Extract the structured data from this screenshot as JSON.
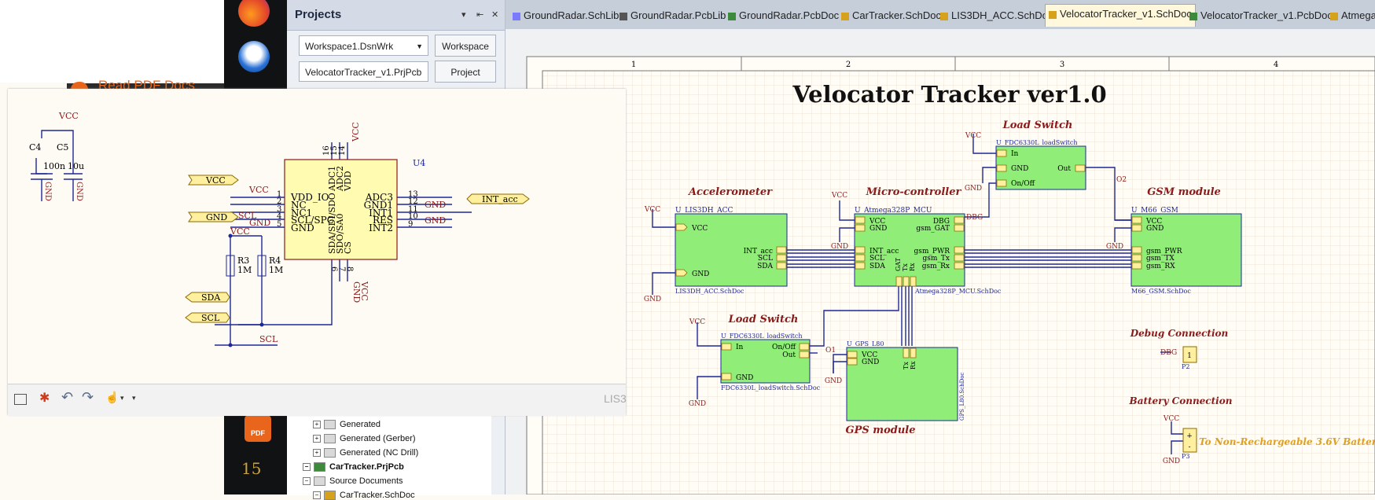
{
  "window": {
    "overlay_label": "LIS3"
  },
  "projects_panel": {
    "title": "Projects",
    "header_buttons": [
      "▾",
      "⇤",
      "✕"
    ],
    "workspace_combo": "Workspace1.DsnWrk",
    "workspace_button": "Workspace",
    "project_combo": "VelocatorTracker_v1.PrjPcb",
    "project_button": "Project",
    "tree": [
      {
        "label": "Generated",
        "type": "folder"
      },
      {
        "label": "Generated (Gerber)",
        "type": "folder"
      },
      {
        "label": "Generated (NC Drill)",
        "type": "folder"
      },
      {
        "label": "CarTracker.PrjPcb",
        "type": "project"
      },
      {
        "label": "Source Documents",
        "type": "folder"
      },
      {
        "label": "CarTracker.SchDoc",
        "type": "file"
      }
    ]
  },
  "taskbar": {
    "icons": [
      "firefox-icon",
      "thunderbird-icon",
      "pdf-app-icon",
      "number-app-icon"
    ],
    "pdf_app_label": "PDF",
    "number_app_label": "15",
    "banner_text": "Read PDF Docs"
  },
  "tabs": [
    {
      "label": "GroundRadar.SchLib",
      "active": false,
      "color": "#7a7aff"
    },
    {
      "label": "GroundRadar.PcbLib",
      "active": false,
      "color": "#555555"
    },
    {
      "label": "GroundRadar.PcbDoc",
      "active": false,
      "color": "#3d8a3d"
    },
    {
      "label": "CarTracker.SchDoc",
      "active": false,
      "color": "#d6a21b"
    },
    {
      "label": "LIS3DH_ACC.SchDoc",
      "active": false,
      "color": "#d6a21b"
    },
    {
      "label": "VelocatorTracker_v1.SchDoc",
      "active": true,
      "color": "#d6a21b"
    },
    {
      "label": "VelocatorTracker_v1.PcbDoc",
      "active": false,
      "color": "#3d8a3d"
    },
    {
      "label": "Atmega",
      "active": false,
      "color": "#d6a21b"
    }
  ],
  "main_schematic": {
    "title": "Velocator Tracker ver1.0",
    "columns": [
      "1",
      "2",
      "3",
      "4"
    ],
    "blocks": {
      "accelerometer": {
        "heading": "Accelerometer",
        "designator": "U_LIS3DH_ACC",
        "file": "LIS3DH_ACC.SchDoc",
        "ports_left": [
          "VCC",
          "GND"
        ],
        "ports_right": [
          "INT_acc",
          "SCL",
          "SDA"
        ]
      },
      "mcu": {
        "heading": "Micro-controller",
        "designator": "U_Atmega328P_MCU",
        "file": "Atmega328P_MCU.SchDoc",
        "ports_left": [
          "VCC",
          "GND",
          "INT_acc",
          "SCL",
          "SDA"
        ],
        "ports_right": [
          "DBG",
          "gsm_GAT",
          "gsm_PWR",
          "gsm_Tx",
          "gsm_Rx"
        ],
        "ports_bottom": [
          "GAT",
          "Tx",
          "Rx"
        ]
      },
      "gsm": {
        "heading": "GSM module",
        "designator": "U_M66_GSM",
        "file": "M66_GSM.SchDoc",
        "ports_left": [
          "VCC",
          "GND",
          "gsm_PWR",
          "gsm_TX",
          "gsm_RX"
        ]
      },
      "load_switch_top": {
        "heading": "Load Switch",
        "designator": "U_FDC6330L_loadSwitch",
        "ports_left": [
          "In",
          "GND",
          "On/Off"
        ],
        "ports_right": [
          "Out"
        ]
      },
      "load_switch_bottom": {
        "heading": "Load Switch",
        "designator": "U_FDC6330L_loadSwitch",
        "file": "FDC6330L_loadSwitch.SchDoc",
        "ports_left": [
          "In",
          "GND"
        ],
        "ports_right": [
          "On/Off",
          "Out"
        ]
      },
      "gps": {
        "heading": "GPS module",
        "designator": "U_GPS_L80",
        "file": "GPS_L80.SchDoc",
        "ports_left": [
          "VCC",
          "GND"
        ],
        "ports_top": [
          "Tx",
          "Rx"
        ]
      }
    },
    "net_labels": {
      "o1": "O1",
      "o2": "O2",
      "dbg": "DBG"
    },
    "debug": {
      "heading": "Debug Connection",
      "net": "DBG",
      "pin": "1",
      "designator": "P2"
    },
    "battery": {
      "heading": "Battery Connection",
      "designator": "P3",
      "note": "To Non-Rechargeable 3.6V Battery",
      "pins": [
        "+",
        "-"
      ]
    },
    "power_labels": {
      "vcc": "VCC",
      "gnd": "GND"
    }
  },
  "overlay_schematic": {
    "caps": [
      {
        "ref": "C4",
        "value": "100n"
      },
      {
        "ref": "C5",
        "value": "10u"
      }
    ],
    "top_vcc": "VCC",
    "ic": {
      "ref": "U4",
      "left_pins": [
        {
          "num": "1",
          "name": "VDD_IO"
        },
        {
          "num": "2",
          "name": "NC"
        },
        {
          "num": "3",
          "name": "NC1"
        },
        {
          "num": "4",
          "name": "SCL/SPC"
        },
        {
          "num": "5",
          "name": "GND"
        }
      ],
      "right_pins": [
        {
          "num": "13",
          "name": "ADC3"
        },
        {
          "num": "12",
          "name": "GND1"
        },
        {
          "num": "11",
          "name": "INT1"
        },
        {
          "num": "10",
          "name": "RES"
        },
        {
          "num": "9",
          "name": "INT2"
        }
      ],
      "top_pins": [
        {
          "num": "16",
          "name": "ADC1"
        },
        {
          "num": "15",
          "name": "ADC2"
        },
        {
          "num": "14",
          "name": "VDD"
        }
      ],
      "bottom_pins": [
        {
          "num": "6",
          "name": "SDA/SDI/SDO"
        },
        {
          "num": "7",
          "name": "SDO/SA0"
        },
        {
          "num": "8",
          "name": "CS"
        }
      ]
    },
    "ports": {
      "vcc": "VCC",
      "gnd": "GND",
      "sda": "SDA",
      "scl": "SCL",
      "int": "INT_acc"
    },
    "net_labels": {
      "vcc": "VCC",
      "gnd": "GND",
      "scl": "SCL"
    },
    "resistors": [
      {
        "ref": "R3",
        "value": "1M"
      },
      {
        "ref": "R4",
        "value": "1M"
      }
    ]
  },
  "colors": {
    "block_fill": "#90ee78",
    "wire": "#1e2896",
    "power": "#8b1a1a",
    "port_fill": "#fff0a0",
    "ic_fill": "#fffbb0",
    "heading": "#8b1a1a"
  }
}
